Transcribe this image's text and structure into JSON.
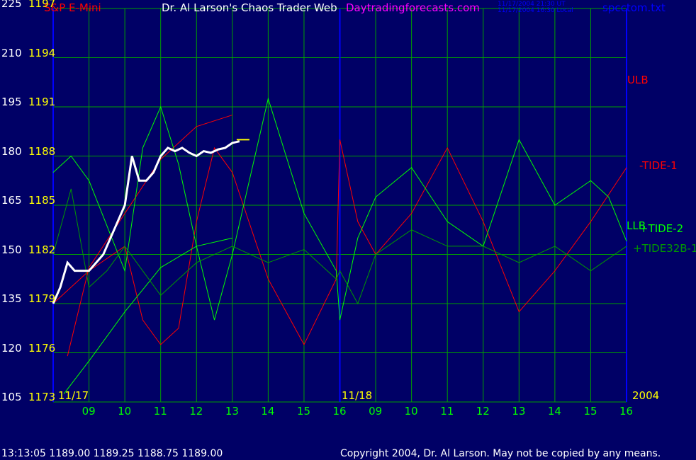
{
  "header": {
    "instrument": "S&P E-Mini",
    "title": "Dr. Al Larson's Chaos Trader Web",
    "site": "Daytradingforecasts.com",
    "stamp_ut": "11/17/2004 21:30 UT",
    "stamp_local": "11/17/2004 16:30 Local",
    "file": "spcctom.txt"
  },
  "footer": {
    "quote": "13:13:05  1189.00 1189.25 1188.75 1189.00",
    "copyright": "Copyright 2004, Dr. Al Larson. May not be copied by any means."
  },
  "colors": {
    "background": "#000066",
    "grid": "#00A000",
    "price_bars": "#FFFFFF",
    "yellow_labels": "#FFFF00",
    "green_labels": "#00FF00",
    "red": "#FF0000",
    "blue": "#0000FF",
    "magenta": "#FF00FF",
    "dark_green": "#009900"
  },
  "chart_data": {
    "type": "line",
    "y_left_outer": [
      "225",
      "210",
      "195",
      "180",
      "165",
      "150",
      "135",
      "120",
      "105"
    ],
    "y_left_inner": [
      "1197",
      "1194",
      "1191",
      "1188",
      "1185",
      "1182",
      "1179",
      "1176",
      "1173"
    ],
    "y_range_price": [
      1173,
      1197
    ],
    "y_range_index": [
      105,
      225
    ],
    "x_time_labels": [
      "09",
      "10",
      "11",
      "12",
      "13",
      "14",
      "15",
      "16",
      "09",
      "10",
      "11",
      "12",
      "13",
      "14",
      "15",
      "16"
    ],
    "date_labels": [
      "11/17",
      "11/18"
    ],
    "year_label": "2004",
    "session_boundaries_hours": [
      0,
      8,
      16
    ],
    "x_range_hours": [
      0,
      16
    ],
    "series": [
      {
        "name": "ULB",
        "color": "#FF0000",
        "x": [
          0.4,
          1,
          2,
          3,
          4,
          5
        ],
        "y": [
          1175.8,
          1181.2,
          1184.5,
          1187.8,
          1189.8,
          1190.5
        ]
      },
      {
        "name": "-TIDE-1",
        "color": "#FF0000",
        "x": [
          0,
          1,
          2,
          2.5,
          3,
          3.5,
          4,
          4.5,
          5,
          6,
          7,
          7.9,
          8,
          8.5,
          9,
          10,
          11,
          12,
          13,
          14,
          15,
          16
        ],
        "y": [
          1179,
          1181,
          1182.5,
          1178,
          1176.5,
          1177.5,
          1184,
          1188.5,
          1187,
          1180.5,
          1176.5,
          1180.5,
          1189,
          1184,
          1182,
          1184.5,
          1188.5,
          1184,
          1178.5,
          1181,
          1184,
          1187.3
        ]
      },
      {
        "name": "LLB",
        "color": "#00FF00",
        "x": [
          0.3,
          1,
          2,
          3,
          4,
          5
        ],
        "y": [
          1173.5,
          1175.5,
          1178.5,
          1181.2,
          1182.5,
          1183
        ]
      },
      {
        "name": "+TIDE-2",
        "color": "#00FF00",
        "x": [
          0,
          0.5,
          1,
          2,
          2.5,
          3,
          3.5,
          4,
          4.5,
          5,
          6,
          7,
          7.9,
          8,
          8.5,
          9,
          10,
          11,
          12,
          13,
          14,
          15,
          15.5,
          16
        ],
        "y": [
          1187,
          1188,
          1186.5,
          1181,
          1188.5,
          1191,
          1187.5,
          1182.5,
          1178,
          1182,
          1191.5,
          1184.5,
          1181,
          1178,
          1183,
          1185.5,
          1187.3,
          1184,
          1182.5,
          1189,
          1185,
          1186.5,
          1185.5,
          1182.8
        ]
      },
      {
        "name": "+TIDE32B-1",
        "color": "#009900",
        "x": [
          0,
          0.5,
          1,
          1.5,
          2,
          2.5,
          3,
          4,
          5,
          6,
          7,
          7.9,
          8,
          8.5,
          9,
          10,
          11,
          12,
          13,
          14,
          15,
          16
        ],
        "y": [
          1182,
          1186,
          1180,
          1181,
          1182.5,
          1181,
          1179.5,
          1181.5,
          1182.5,
          1181.5,
          1182.3,
          1180.5,
          1181,
          1179,
          1182,
          1183.5,
          1182.5,
          1182.5,
          1181.5,
          1182.5,
          1181,
          1182.5
        ]
      }
    ],
    "price_path": {
      "x": [
        0,
        0.2,
        0.4,
        0.6,
        0.8,
        1,
        1.2,
        1.4,
        1.6,
        1.8,
        2,
        2.2,
        2.4,
        2.6,
        2.8,
        3,
        3.2,
        3.4,
        3.6,
        3.8,
        4,
        4.2,
        4.4,
        4.6,
        4.8,
        5,
        5.2
      ],
      "y": [
        1179,
        1180,
        1181.5,
        1181,
        1181,
        1181,
        1181.5,
        1182,
        1183,
        1184,
        1185,
        1188,
        1186.5,
        1186.5,
        1187,
        1188,
        1188.5,
        1188.3,
        1188.5,
        1188.2,
        1188,
        1188.3,
        1188.2,
        1188.4,
        1188.5,
        1188.8,
        1188.9
      ]
    },
    "last_price": 1189
  }
}
